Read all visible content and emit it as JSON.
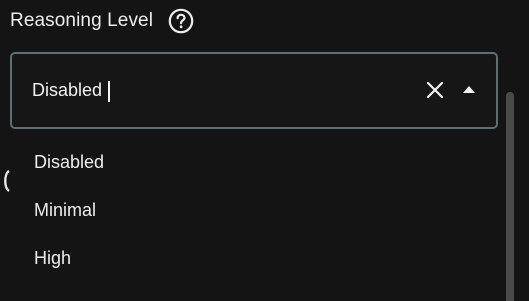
{
  "header": {
    "title": "Reasoning Level",
    "help_icon": "question-circle-icon"
  },
  "select": {
    "value": "Disabled",
    "clear_icon": "close-icon",
    "toggle_icon": "chevron-up-icon",
    "expanded": true
  },
  "menu": {
    "items": [
      {
        "label": "Disabled"
      },
      {
        "label": "Minimal"
      },
      {
        "label": "High"
      }
    ]
  },
  "colors": {
    "background": "#141414",
    "border": "#5f6e72",
    "text": "#ececec"
  }
}
